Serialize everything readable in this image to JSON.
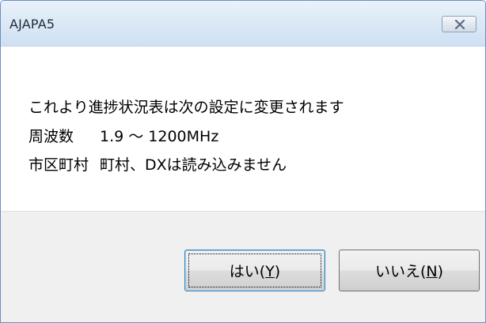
{
  "window": {
    "title": "AJAPA5",
    "close_icon": "close-icon"
  },
  "message": {
    "line1": "これより進捗状況表は次の設定に変更されます",
    "frequency_label": "周波数",
    "frequency_value": "1.9 ～ 1200MHz",
    "city_label": "市区町村",
    "city_value": "町村、DXは読み込みません"
  },
  "buttons": {
    "yes": {
      "prefix": "はい(",
      "mnemonic": "Y",
      "suffix": ")"
    },
    "no": {
      "prefix": "いいえ(",
      "mnemonic": "N",
      "suffix": ")"
    }
  }
}
